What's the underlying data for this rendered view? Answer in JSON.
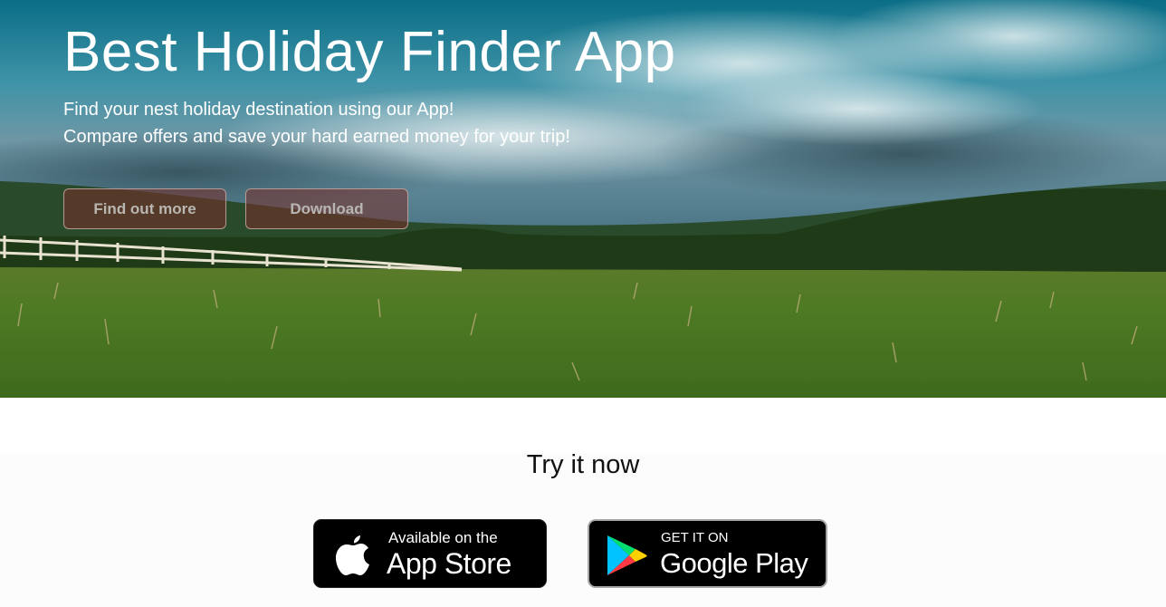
{
  "hero": {
    "title": "Best Holiday Finder App",
    "subtitle_line1": "Find your nest holiday destination using our App!",
    "subtitle_line2": "Compare offers and save your hard earned money for your trip!",
    "buttons": {
      "find_out_more": "Find out more",
      "download": "Download"
    }
  },
  "try_section": {
    "title": "Try it now",
    "app_store": {
      "small_text": "Available on the",
      "big_text": "App Store",
      "icon": "apple-icon"
    },
    "google_play": {
      "small_text": "GET IT ON",
      "big_text": "Google Play",
      "icon": "google-play-icon"
    }
  },
  "colors": {
    "button_bg": "#782d28",
    "button_text": "#b9b6b2",
    "badge_bg": "#000000"
  }
}
